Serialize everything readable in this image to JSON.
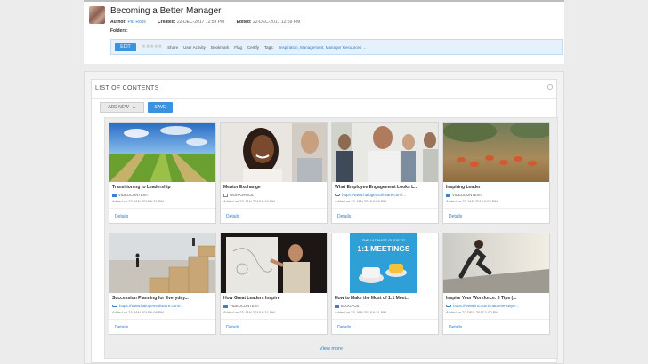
{
  "header": {
    "title": "Becoming a Better Manager",
    "author_label": "Author:",
    "author": "Pat Ross",
    "created_label": "Created:",
    "created": "22-DEC-2017 12:59 PM",
    "edited_label": "Edited:",
    "edited": "22-DEC-2017 12:59 PM",
    "folders_label": "Folders:"
  },
  "actions": {
    "edit": "EDIT",
    "stars": "★★★★★",
    "share": "Share",
    "user_activity": "User Activity",
    "bookmark": "Bookmark",
    "flag": "Flag",
    "certify": "Certify",
    "tags_label": "Tags:",
    "tags": "Inspiration, Management, Manager Resources ..."
  },
  "list": {
    "title": "LIST OF CONTENTS",
    "add_new": "ADD NEW",
    "save": "SAVE",
    "view_more": "View more"
  },
  "tiles": [
    {
      "title": "Transitioning to Leadership",
      "type": "VIDEOCONTENT",
      "icon": "video-icon",
      "date": "Added on 23-JAN-2018 6:31 PM",
      "details": "Details"
    },
    {
      "title": "Mentor Exchange",
      "type": "WORKSPACE",
      "icon": "workspace-icon",
      "date": "Added on 23-JAN-2018 6:19 PM",
      "details": "Details"
    },
    {
      "title": "What Employee Engagement Looks L...",
      "type": "https://www.halogensoftware.com/...",
      "icon": "link-icon",
      "date": "Added on 23-JAN-2018 6:59 PM",
      "details": "Details"
    },
    {
      "title": "Inspiring Leader",
      "type": "VIDEOCONTENT",
      "icon": "video-icon",
      "date": "Added on 23-JAN-2018 6:52 PM",
      "details": "Details"
    },
    {
      "title": "Succession Planning for Everyday...",
      "type": "https://www.halogensoftware.com/...",
      "icon": "link-icon",
      "date": "Added on 23-JAN-2018 6:08 PM",
      "details": "Details"
    },
    {
      "title": "How Great Leaders Inspire",
      "type": "VIDEOCONTENT",
      "icon": "video-icon",
      "date": "Added on 23-JAN-2018 6:21 PM",
      "details": "Details"
    },
    {
      "title": "How to Make the Most of 1:1 Meet...",
      "type": "BLOGPOST",
      "icon": "blog-icon",
      "date": "Added on 23-JAN-2018 6:21 PM",
      "details": "Details"
    },
    {
      "title": "Inspire Your Workforce: 3 Tips (...",
      "type": "https://www.inc.com/matthew-swye...",
      "icon": "link-icon",
      "date": "Added on 22-DEC-2017 1:00 PM",
      "details": "Details"
    }
  ],
  "thumb_text": {
    "meetings_top": "THE ULTIMATE GUIDE TO",
    "meetings_big": "1:1 MEETINGS"
  }
}
